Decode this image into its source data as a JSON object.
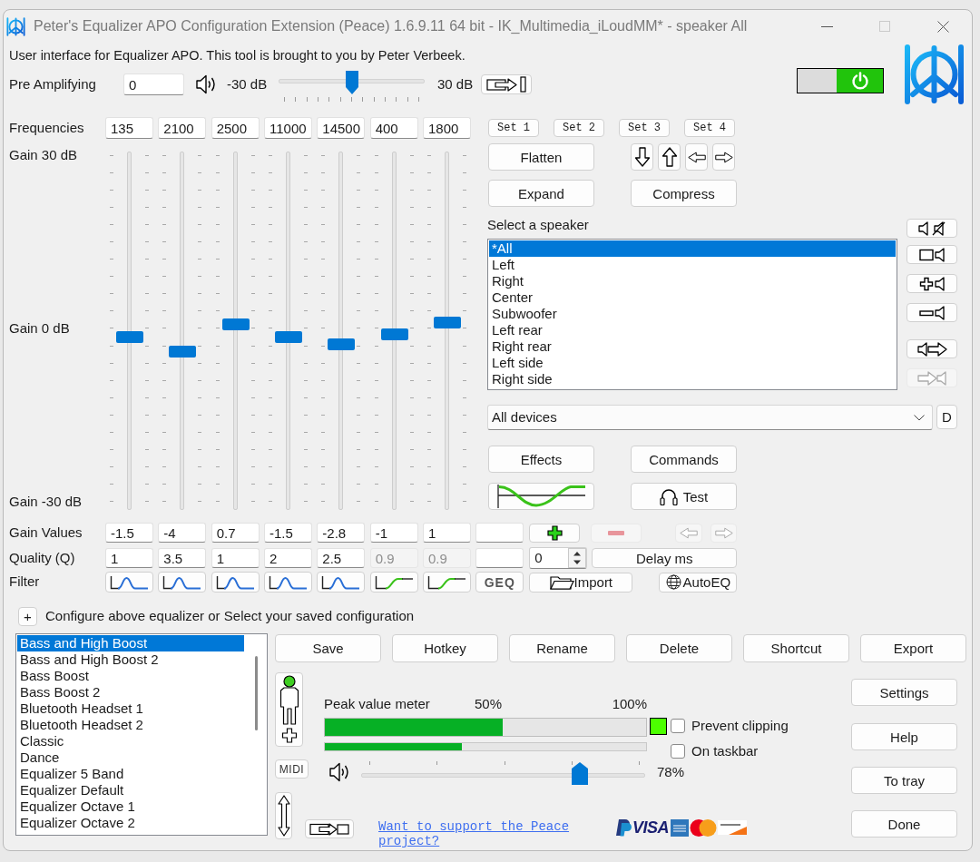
{
  "window": {
    "title": "Peter's Equalizer APO Configuration Extension (Peace) 1.6.9.11 64 bit - IK_Multimedia_iLoudMM* - speaker All"
  },
  "intro": "User interface for Equalizer APO. This tool is brought to you by Peter Verbeek.",
  "pre_amplifying": {
    "label": "Pre Amplifying",
    "value": "0",
    "min_label": "-30 dB",
    "max_label": "30 dB",
    "level": 0.5
  },
  "power": {
    "on": true
  },
  "frequencies": {
    "label": "Frequencies"
  },
  "gain_scale": {
    "top": "Gain 30 dB",
    "middle": "Gain 0 dB",
    "bottom": "Gain -30 dB"
  },
  "bands": [
    {
      "frequency": "135",
      "level": 0.475,
      "gain": "-1.5",
      "quality": "1",
      "quality_disabled": false,
      "kind": "peak"
    },
    {
      "frequency": "2100",
      "level": 0.4333,
      "gain": "-4",
      "quality": "3.5",
      "quality_disabled": false,
      "kind": "peak"
    },
    {
      "frequency": "2500",
      "level": 0.5117,
      "gain": "0.7",
      "quality": "1",
      "quality_disabled": false,
      "kind": "peak"
    },
    {
      "frequency": "11000",
      "level": 0.475,
      "gain": "-1.5",
      "quality": "2",
      "quality_disabled": false,
      "kind": "peak"
    },
    {
      "frequency": "14500",
      "level": 0.4533,
      "gain": "-2.8",
      "quality": "2.5",
      "quality_disabled": false,
      "kind": "peak"
    },
    {
      "frequency": "400",
      "level": 0.4833,
      "gain": "-1",
      "quality": "0.9",
      "quality_disabled": true,
      "kind": "shelf"
    },
    {
      "frequency": "1800",
      "level": 0.5167,
      "gain": "1",
      "quality": "0.9",
      "quality_disabled": true,
      "kind": "shelf"
    }
  ],
  "row_labels": {
    "gain": "Gain Values",
    "quality": "Quality (Q)",
    "filter": "Filter"
  },
  "extra_column": {
    "filter_button": "GEQ"
  },
  "sets": [
    "Set 1",
    "Set 2",
    "Set 3",
    "Set 4"
  ],
  "actions": {
    "flatten": "Flatten",
    "expand": "Expand",
    "compress": "Compress",
    "effects": "Effects",
    "commands": "Commands",
    "test": "Test"
  },
  "speakers": {
    "label": "Select a speaker",
    "items": [
      {
        "label": "*All",
        "selected": true
      },
      {
        "label": "Left",
        "selected": false
      },
      {
        "label": "Right",
        "selected": false
      },
      {
        "label": "Center",
        "selected": false
      },
      {
        "label": "Subwoofer",
        "selected": false
      },
      {
        "label": "Left rear",
        "selected": false
      },
      {
        "label": "Right rear",
        "selected": false
      },
      {
        "label": "Left side",
        "selected": false
      },
      {
        "label": "Right side",
        "selected": false
      }
    ]
  },
  "speaker_tools": [
    {
      "kind": "mute",
      "disabled": false
    },
    {
      "kind": "square",
      "disabled": false
    },
    {
      "kind": "plus",
      "disabled": false
    },
    {
      "kind": "minus",
      "disabled": false
    },
    {
      "kind": "copy",
      "disabled": false
    },
    {
      "kind": "paste",
      "disabled": true
    }
  ],
  "device": {
    "value": "All devices",
    "button": "D"
  },
  "band_tools": [
    {
      "kind": "add",
      "disabled": false
    },
    {
      "kind": "remove",
      "disabled": true
    },
    {
      "kind": "left",
      "disabled": true
    },
    {
      "kind": "right",
      "disabled": true
    }
  ],
  "delay": {
    "value": "0",
    "button": "Delay ms"
  },
  "import_button": "Import",
  "autoeq_button": "AutoEQ",
  "configuration": {
    "expand_button": "+",
    "label": "Configure above equalizer or Select your saved configuration",
    "items": [
      {
        "label": "Bass and High Boost",
        "selected": true
      },
      {
        "label": "Bass and High Boost 2",
        "selected": false
      },
      {
        "label": "Bass Boost",
        "selected": false
      },
      {
        "label": "Bass Boost 2",
        "selected": false
      },
      {
        "label": "Bluetooth Headset 1",
        "selected": false
      },
      {
        "label": "Bluetooth Headset 2",
        "selected": false
      },
      {
        "label": "Classic",
        "selected": false
      },
      {
        "label": "Dance",
        "selected": false
      },
      {
        "label": "Equalizer 5 Band",
        "selected": false
      },
      {
        "label": "Equalizer Default",
        "selected": false
      },
      {
        "label": "Equalizer Octave 1",
        "selected": false
      },
      {
        "label": "Equalizer Octave 2",
        "selected": false
      }
    ],
    "buttons": [
      "Save",
      "Hotkey",
      "Rename",
      "Delete",
      "Shortcut",
      "Export"
    ]
  },
  "midi_button": "MIDI",
  "meter": {
    "label": "Peak value meter",
    "mid_label": "50%",
    "max_label": "100%",
    "peak": {
      "level": 0.555
    },
    "average": {
      "level": 0.427
    }
  },
  "options": [
    {
      "label": "Prevent clipping",
      "checked": false
    },
    {
      "label": "On taskbar",
      "checked": false
    }
  ],
  "volume": {
    "level": 0.78,
    "reading": "78%"
  },
  "support_link": "Want to support the Peace project?",
  "payment": {
    "visa": "VISA"
  },
  "side_buttons": [
    "Settings",
    "Help",
    "To tray",
    "Done"
  ]
}
